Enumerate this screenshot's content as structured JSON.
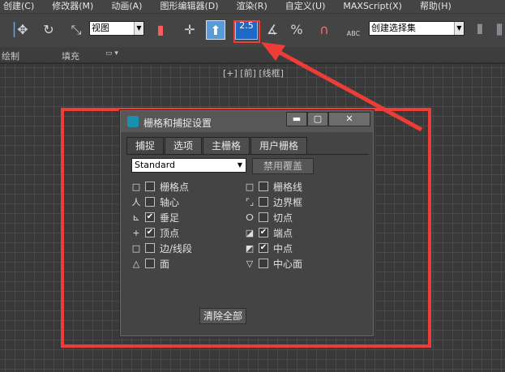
{
  "menubar": [
    "创建(C)",
    "修改器(M)",
    "动画(A)",
    "图形编辑器(D)",
    "渲染(R)",
    "自定义(U)",
    "MAXScript(X)",
    "帮助(H)"
  ],
  "toolbar": {
    "view_combo": "视图",
    "snap_value": "2.5",
    "selection_set": "创建选择集",
    "abc_label": "ABC"
  },
  "ribbon": {
    "paint": "绘制",
    "fill": "填充"
  },
  "viewport_label": "[+] [前] [线框]",
  "dialog": {
    "title": "栅格和捕捉设置",
    "tabs": [
      "捕捉",
      "选项",
      "主栅格",
      "用户栅格"
    ],
    "snap_type": "Standard",
    "override_button": "禁用覆盖",
    "clear_button": "清除全部",
    "left": [
      {
        "sym": "□",
        "label": "栅格点",
        "checked": false
      },
      {
        "sym": "人",
        "label": "轴心",
        "checked": false
      },
      {
        "sym": "⊾",
        "label": "垂足",
        "checked": true
      },
      {
        "sym": "+",
        "label": "顶点",
        "checked": true
      },
      {
        "sym": "□",
        "label": "边/线段",
        "checked": false
      },
      {
        "sym": "△",
        "label": "面",
        "checked": false
      }
    ],
    "right": [
      {
        "sym": "□",
        "label": "栅格线",
        "checked": false
      },
      {
        "sym": "⌜⌟",
        "label": "边界框",
        "checked": false
      },
      {
        "sym": "ⵔ",
        "label": "切点",
        "checked": false
      },
      {
        "sym": "◪",
        "label": "端点",
        "checked": true
      },
      {
        "sym": "◩",
        "label": "中点",
        "checked": true
      },
      {
        "sym": "▽",
        "label": "中心面",
        "checked": false
      }
    ]
  },
  "annotation_color": "#ee3c36"
}
